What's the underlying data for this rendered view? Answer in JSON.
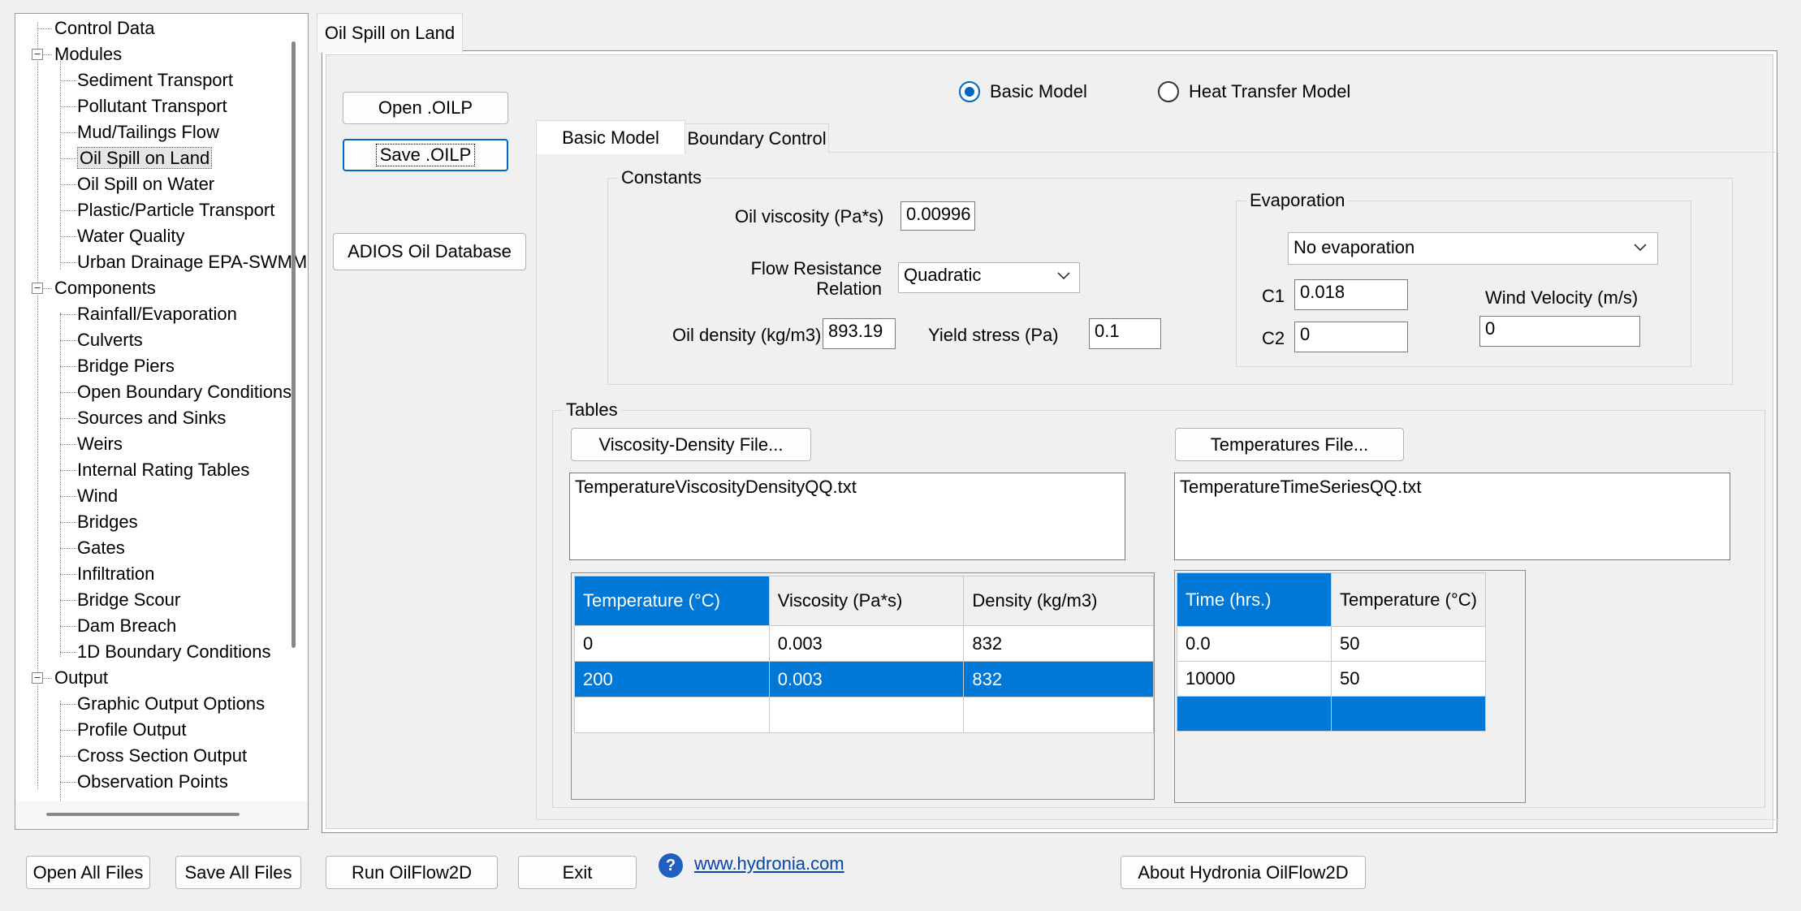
{
  "tree": {
    "items": [
      {
        "label": "Control Data"
      },
      {
        "label": "Modules"
      },
      {
        "label": "Sediment Transport"
      },
      {
        "label": "Pollutant Transport"
      },
      {
        "label": "Mud/Tailings Flow"
      },
      {
        "label": "Oil Spill on Land"
      },
      {
        "label": "Oil Spill on Water"
      },
      {
        "label": "Plastic/Particle Transport"
      },
      {
        "label": "Water Quality"
      },
      {
        "label": "Urban Drainage EPA-SWMM"
      },
      {
        "label": "Components"
      },
      {
        "label": "Rainfall/Evaporation"
      },
      {
        "label": "Culverts"
      },
      {
        "label": "Bridge Piers"
      },
      {
        "label": "Open Boundary Conditions"
      },
      {
        "label": "Sources and Sinks"
      },
      {
        "label": "Weirs"
      },
      {
        "label": "Internal Rating Tables"
      },
      {
        "label": "Wind"
      },
      {
        "label": "Bridges"
      },
      {
        "label": "Gates"
      },
      {
        "label": "Infiltration"
      },
      {
        "label": "Bridge Scour"
      },
      {
        "label": "Dam Breach"
      },
      {
        "label": "1D Boundary Conditions"
      },
      {
        "label": "Output"
      },
      {
        "label": "Graphic Output Options"
      },
      {
        "label": "Profile Output"
      },
      {
        "label": "Cross Section Output"
      },
      {
        "label": "Observation Points"
      }
    ],
    "expander_minus": "−"
  },
  "main_tab": {
    "label": "Oil Spill on Land"
  },
  "left_buttons": {
    "open": "Open .OILP",
    "save": "Save .OILP",
    "adios": "ADIOS Oil Database"
  },
  "model_choice": {
    "basic": "Basic Model",
    "heat": "Heat Transfer Model",
    "selected": "basic"
  },
  "inner_tabs": {
    "basic": "Basic Model",
    "boundary": "Boundary Control"
  },
  "constants": {
    "title": "Constants",
    "oil_viscosity_label": "Oil viscosity (Pa*s)",
    "oil_viscosity_value": "0.00996",
    "flow_resistance_label_1": "Flow Resistance",
    "flow_resistance_label_2": "Relation",
    "flow_resistance_value": "Quadratic",
    "oil_density_label": "Oil density (kg/m3)",
    "oil_density_value": "893.19",
    "yield_stress_label": "Yield stress (Pa)",
    "yield_stress_value": "0.1"
  },
  "evaporation": {
    "title": "Evaporation",
    "mode": "No evaporation",
    "c1_label": "C1",
    "c1_value": "0.018",
    "c2_label": "C2",
    "c2_value": "0",
    "wind_label": "Wind Velocity (m/s)",
    "wind_value": "0"
  },
  "tables": {
    "title": "Tables",
    "visc_button": "Viscosity-Density File...",
    "temp_button": "Temperatures File...",
    "visc_file": "TemperatureViscosityDensityQQ.txt",
    "temp_file": "TemperatureTimeSeriesQQ.txt",
    "visc_headers": [
      "Temperature (°C)",
      "Viscosity (Pa*s)",
      "Density (kg/m3)"
    ],
    "visc_rows": [
      [
        "0",
        "0.003",
        "832"
      ],
      [
        "200",
        "0.003",
        "832"
      ]
    ],
    "temp_headers": [
      "Time (hrs.)",
      "Temperature (°C)"
    ],
    "temp_rows": [
      [
        "0.0",
        "50"
      ],
      [
        "10000",
        "50"
      ]
    ]
  },
  "bottom": {
    "open_all": "Open All Files",
    "save_all": "Save All Files",
    "run": "Run OilFlow2D",
    "exit": "Exit",
    "link": "www.hydronia.com",
    "about": "About Hydronia OilFlow2D"
  },
  "icons": {
    "help": "?",
    "chevron": "⌄"
  },
  "colors": {
    "accent": "#0078d7",
    "radio": "#0067c0",
    "link": "#0645ad"
  }
}
